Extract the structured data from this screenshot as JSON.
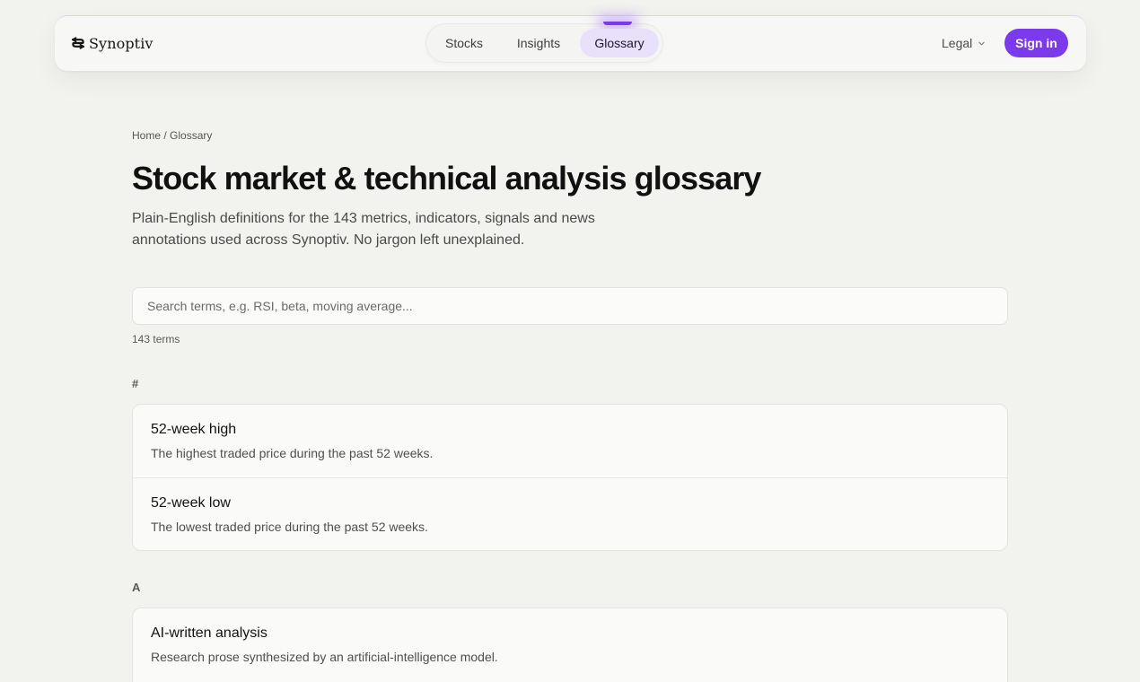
{
  "brand": {
    "name": "Synoptiv"
  },
  "nav": {
    "tabs": [
      {
        "label": "Stocks",
        "active": false
      },
      {
        "label": "Insights",
        "active": false
      },
      {
        "label": "Glossary",
        "active": true
      }
    ],
    "legal_label": "Legal",
    "signin_label": "Sign in"
  },
  "colors": {
    "accent": "#7c3aed",
    "active_tab_bg": "#e9e1fb",
    "page_bg": "#f2f2ef"
  },
  "breadcrumb": {
    "home": "Home",
    "separator": " / ",
    "current": "Glossary"
  },
  "page": {
    "title": "Stock market & technical analysis glossary",
    "subtitle": "Plain-English definitions for the 143 metrics, indicators, signals and news annotations used across Synoptiv. No jargon left unexplained."
  },
  "search": {
    "placeholder": "Search terms, e.g. RSI, beta, moving average...",
    "value": ""
  },
  "term_count": "143 terms",
  "sections": [
    {
      "letter": "#",
      "terms": [
        {
          "name": "52-week high",
          "definition": "The highest traded price during the past 52 weeks."
        },
        {
          "name": "52-week low",
          "definition": "The lowest traded price during the past 52 weeks."
        }
      ]
    },
    {
      "letter": "A",
      "terms": [
        {
          "name": "AI-written analysis",
          "definition": "Research prose synthesized by an artificial-intelligence model."
        }
      ]
    }
  ]
}
